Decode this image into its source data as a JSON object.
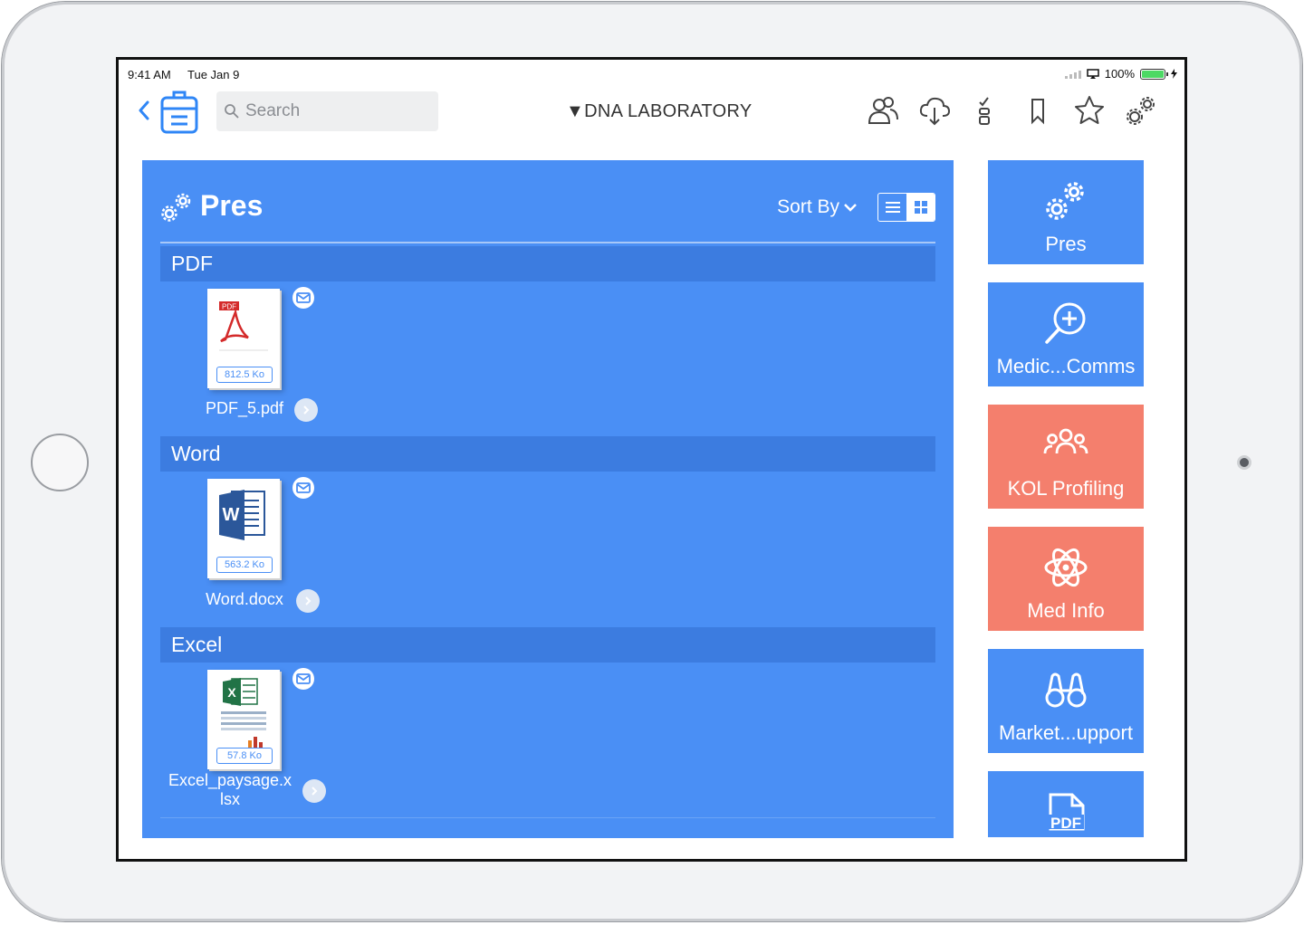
{
  "status_bar": {
    "time": "9:41 AM",
    "date": "Tue Jan 9",
    "battery": "100%"
  },
  "nav": {
    "back_icon": "chevron-left-icon",
    "search_placeholder": "Search",
    "title": "▼DNA LABORATORY",
    "icons": [
      "users-icon",
      "cloud-download-icon",
      "checklist-icon",
      "bookmark-icon",
      "star-icon",
      "gears-icon"
    ]
  },
  "panel": {
    "title": "Pres",
    "sort_label": "Sort By",
    "view_modes": [
      "list",
      "grid"
    ],
    "active_view": "grid",
    "sections": [
      {
        "name": "PDF",
        "file": {
          "name": "PDF_5.pdf",
          "size": "812.5 Ko",
          "type": "pdf"
        }
      },
      {
        "name": "Word",
        "file": {
          "name": "Word.docx",
          "size": "563.2 Ko",
          "type": "word"
        }
      },
      {
        "name": "Excel",
        "file": {
          "name_line1": "Excel_paysage.x",
          "name_line2": "lsx",
          "size": "57.8 Ko",
          "type": "excel"
        }
      }
    ]
  },
  "tiles": [
    {
      "label": "Pres",
      "icon": "gears-icon",
      "color": "#4a8ff5"
    },
    {
      "label": "Medic...Comms",
      "icon": "zoom-in-icon",
      "color": "#4a8ff5"
    },
    {
      "label": "KOL Profiling",
      "icon": "group-icon",
      "color": "#f47f6d"
    },
    {
      "label": "Med Info",
      "icon": "atom-icon",
      "color": "#f47f6d"
    },
    {
      "label": "Market...upport",
      "icon": "binoculars-icon",
      "color": "#4a8ff5"
    },
    {
      "label": "",
      "icon": "pdf-file-icon",
      "color": "#4a8ff5"
    }
  ]
}
